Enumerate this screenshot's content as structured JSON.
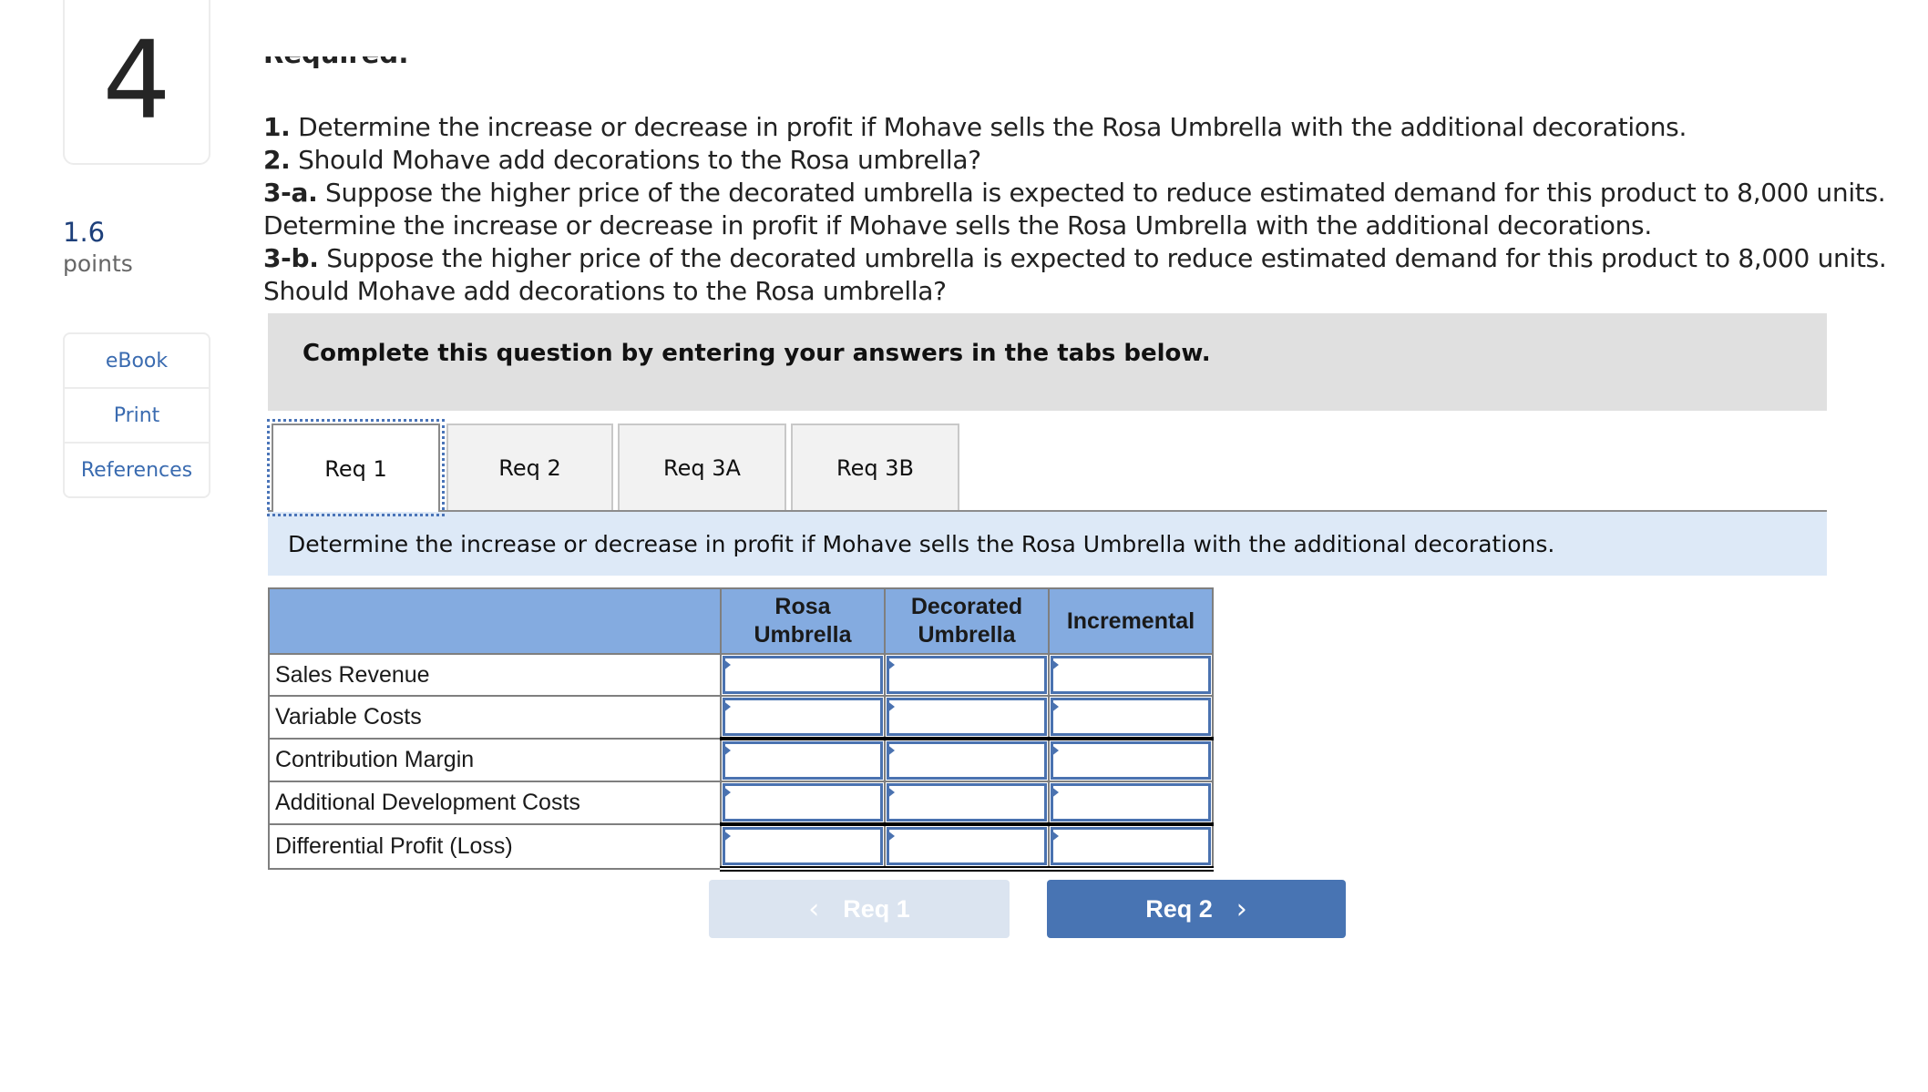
{
  "question": {
    "number": "4",
    "points_value": "1.6",
    "points_label": "points"
  },
  "tools": [
    {
      "label": "eBook"
    },
    {
      "label": "Print"
    },
    {
      "label": "References"
    }
  ],
  "required": {
    "heading": "Required:",
    "items": [
      {
        "num": "1.",
        "text": " Determine the increase or decrease in profit if Mohave sells the Rosa Umbrella with the additional decorations."
      },
      {
        "num": "2.",
        "text": " Should Mohave add decorations to the Rosa umbrella?"
      },
      {
        "num": "3-a.",
        "text": " Suppose the higher price of the decorated umbrella is expected to reduce estimated demand for this product to 8,000 units."
      },
      {
        "num": "",
        "text": "Determine the increase or decrease in profit if Mohave sells the Rosa Umbrella with the additional decorations."
      },
      {
        "num": "3-b.",
        "text": " Suppose the higher price of the decorated umbrella is expected to reduce estimated demand for this product to 8,000 units."
      },
      {
        "num": "",
        "text": "Should Mohave add decorations to the Rosa umbrella?"
      }
    ]
  },
  "banner": {
    "text": "Complete this question by entering your answers in the tabs below."
  },
  "tabs": [
    {
      "label": "Req 1",
      "active": true
    },
    {
      "label": "Req 2",
      "active": false
    },
    {
      "label": "Req 3A",
      "active": false
    },
    {
      "label": "Req 3B",
      "active": false
    }
  ],
  "instruction": "Determine the increase or decrease in profit if Mohave sells the Rosa Umbrella with the additional decorations.",
  "table": {
    "columns": [
      "",
      "Rosa Umbrella",
      "Decorated Umbrella",
      "Incremental"
    ],
    "rows": [
      {
        "label": "Sales Revenue",
        "values": [
          "",
          "",
          ""
        ]
      },
      {
        "label": "Variable Costs",
        "values": [
          "",
          "",
          ""
        ]
      },
      {
        "label": "Contribution Margin",
        "values": [
          "",
          "",
          ""
        ]
      },
      {
        "label": "Additional Development Costs",
        "values": [
          "",
          "",
          ""
        ]
      },
      {
        "label": "Differential Profit (Loss)",
        "values": [
          "",
          "",
          ""
        ]
      }
    ]
  },
  "navigation": {
    "prev_label": "Req 1",
    "next_label": "Req 2",
    "prev_icon": "chevron-left-icon",
    "next_icon": "chevron-right-icon",
    "prev_glyph": "‹",
    "next_glyph": "›"
  },
  "colors": {
    "accent": "#4874b3",
    "header_bg": "#84abe0",
    "instruction_bg": "#dde9f7",
    "banner_bg": "#e0e0e0",
    "points_color": "#1d3f7a"
  }
}
